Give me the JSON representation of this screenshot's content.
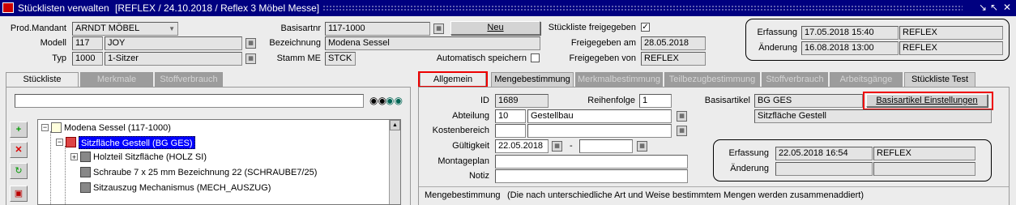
{
  "window": {
    "title": "Stücklisten verwalten",
    "subtitle": "[REFLEX / 24.10.2018 / Reflex 3 Möbel Messe]",
    "controls": [
      "⇲",
      "⇱",
      "✕"
    ]
  },
  "header": {
    "prod_mandant_label": "Prod.Mandant",
    "prod_mandant_value": "ARNDT MÖBEL",
    "modell_label": "Modell",
    "modell_code": "117",
    "modell_name": "JOY",
    "typ_label": "Typ",
    "typ_code": "1000",
    "typ_name": "1-Sitzer",
    "basisartnr_label": "Basisartnr",
    "basisartnr_value": "117-1000",
    "neu_button": "Neu",
    "bezeichnung_label": "Bezeichnung",
    "bezeichnung_value": "Modena Sessel",
    "stamm_me_label": "Stamm ME",
    "stamm_me_value": "STCK",
    "auto_save_label": "Automatisch speichern",
    "auto_save_checked": false,
    "freigegeben_label": "Stückliste freigegeben",
    "freigegeben_checked": true,
    "freigegeben_am_label": "Freigegeben am",
    "freigegeben_am_value": "28.05.2018",
    "freigegeben_von_label": "Freigegeben von",
    "freigegeben_von_value": "REFLEX",
    "erfassung_label": "Erfassung",
    "erfassung_date": "17.05.2018 15:40",
    "erfassung_user": "REFLEX",
    "aenderung_label": "Änderung",
    "aenderung_date": "16.08.2018 13:00",
    "aenderung_user": "REFLEX"
  },
  "left_tabs": [
    {
      "label": "Stückliste",
      "state": "active"
    },
    {
      "label": "Merkmale",
      "state": "disabled"
    },
    {
      "label": "Stoffverbrauch",
      "state": "disabled"
    }
  ],
  "tree": {
    "search_value": "",
    "rows": [
      {
        "label": "Modena Sessel (117-1000)",
        "selected": false
      },
      {
        "label": "Sitzfläche Gestell (BG GES)",
        "selected": true
      },
      {
        "label": "Holzteil Sitzfläche (HOLZ SI)",
        "selected": false
      },
      {
        "label": "Schraube 7 x 25 mm Bezeichnung 22 (SCHRAUBE7/25)",
        "selected": false
      },
      {
        "label": "Sitzauszug Mechanismus (MECH_AUSZUG)",
        "selected": false
      }
    ]
  },
  "right_tabs": [
    {
      "label": "Allgemein",
      "state": "active"
    },
    {
      "label": "Mengebestimmung",
      "state": "enabled"
    },
    {
      "label": "Merkmalbestimmung",
      "state": "disabled"
    },
    {
      "label": "Teilbezugbestimmung",
      "state": "disabled"
    },
    {
      "label": "Stoffverbrauch",
      "state": "disabled"
    },
    {
      "label": "Arbeitsgänge",
      "state": "disabled"
    },
    {
      "label": "Stückliste Test",
      "state": "enabled"
    }
  ],
  "detail": {
    "id_label": "ID",
    "id_value": "1689",
    "reihenfolge_label": "Reihenfolge",
    "reihenfolge_value": "1",
    "abteilung_label": "Abteilung",
    "abteilung_code": "10",
    "abteilung_name": "Gestellbau",
    "kostenbereich_label": "Kostenbereich",
    "kostenbereich_code": "",
    "kostenbereich_name": "",
    "gueltigkeit_label": "Gültigkeit",
    "gueltig_von": "22.05.2018",
    "gueltig_sep": "-",
    "gueltig_bis": "",
    "montageplan_label": "Montageplan",
    "montageplan_value": "",
    "notiz_label": "Notiz",
    "notiz_value": "",
    "basisartikel_label": "Basisartikel",
    "basisartikel_code": "BG GES",
    "basisartikel_button": "Basisartikel Einstellungen",
    "basisartikel_name": "Sitzfläche Gestell",
    "erfassung_label": "Erfassung",
    "erfassung_date": "22.05.2018 16:54",
    "erfassung_user": "REFLEX",
    "aenderung_label": "Änderung",
    "aenderung_date": "",
    "aenderung_user": ""
  },
  "status_bar": {
    "field": "Mengebestimmung",
    "hint": "(Die nach unterschiedliche Art und Weise bestimmtem Mengen werden zusammenaddiert)"
  },
  "colors": {
    "titlebar": "#000080",
    "highlight_red": "#ee0000",
    "selection": "#0000ff"
  }
}
